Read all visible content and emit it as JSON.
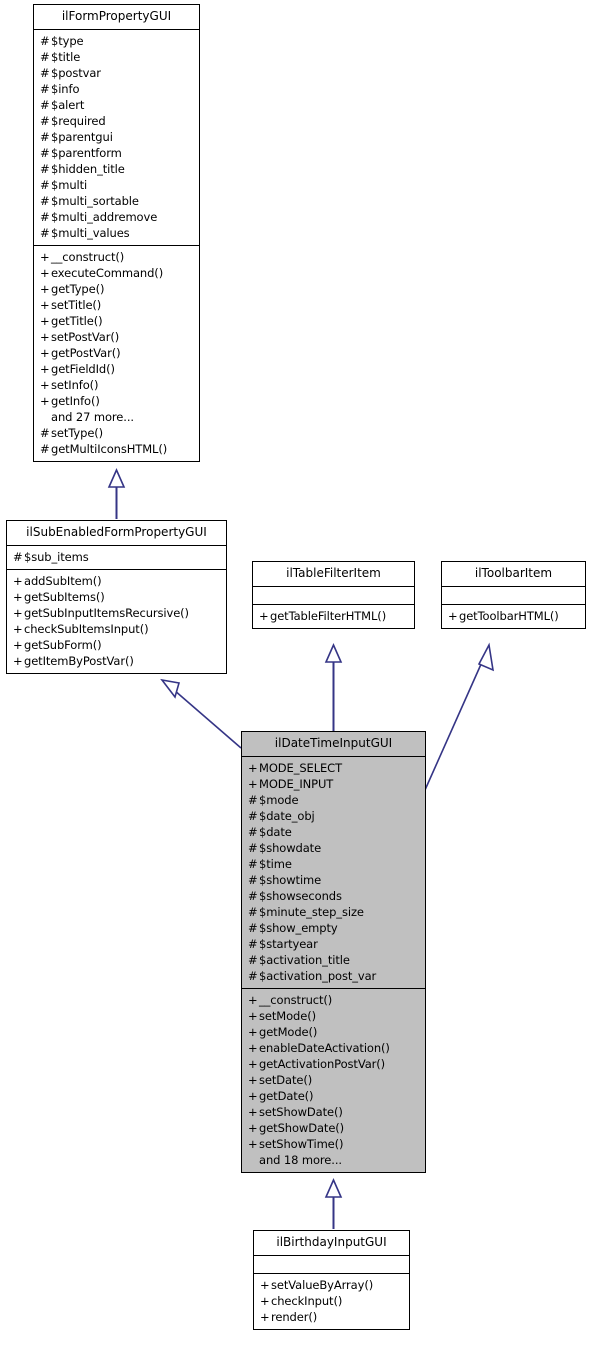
{
  "diagram": {
    "type": "uml-class-inheritance",
    "title": "ilDateTimeInputGUI class hierarchy",
    "line_color": "#353586",
    "highlight_fill": "#c0c0c0",
    "node_fill": "#ffffff",
    "border_color": "#000000"
  },
  "nodes": {
    "il_form_property_gui": {
      "name": "ilFormPropertyGUI",
      "attributes": [
        {
          "visibility": "#",
          "label": "$type"
        },
        {
          "visibility": "#",
          "label": "$title"
        },
        {
          "visibility": "#",
          "label": "$postvar"
        },
        {
          "visibility": "#",
          "label": "$info"
        },
        {
          "visibility": "#",
          "label": "$alert"
        },
        {
          "visibility": "#",
          "label": "$required"
        },
        {
          "visibility": "#",
          "label": "$parentgui"
        },
        {
          "visibility": "#",
          "label": "$parentform"
        },
        {
          "visibility": "#",
          "label": "$hidden_title"
        },
        {
          "visibility": "#",
          "label": "$multi"
        },
        {
          "visibility": "#",
          "label": "$multi_sortable"
        },
        {
          "visibility": "#",
          "label": "$multi_addremove"
        },
        {
          "visibility": "#",
          "label": "$multi_values"
        }
      ],
      "operations": [
        {
          "visibility": "+",
          "label": "__construct()"
        },
        {
          "visibility": "+",
          "label": "executeCommand()"
        },
        {
          "visibility": "+",
          "label": "getType()"
        },
        {
          "visibility": "+",
          "label": "setTitle()"
        },
        {
          "visibility": "+",
          "label": "getTitle()"
        },
        {
          "visibility": "+",
          "label": "setPostVar()"
        },
        {
          "visibility": "+",
          "label": "getPostVar()"
        },
        {
          "visibility": "+",
          "label": "getFieldId()"
        },
        {
          "visibility": "+",
          "label": "setInfo()"
        },
        {
          "visibility": "+",
          "label": "getInfo()"
        },
        {
          "visibility": "",
          "label": "and 27 more..."
        },
        {
          "visibility": "#",
          "label": "setType()"
        },
        {
          "visibility": "#",
          "label": "getMultiIconsHTML()"
        }
      ]
    },
    "il_sub_enabled_form_property_gui": {
      "name": "ilSubEnabledFormPropertyGUI",
      "attributes": [
        {
          "visibility": "#",
          "label": "$sub_items"
        }
      ],
      "operations": [
        {
          "visibility": "+",
          "label": "addSubItem()"
        },
        {
          "visibility": "+",
          "label": "getSubItems()"
        },
        {
          "visibility": "+",
          "label": "getSubInputItemsRecursive()"
        },
        {
          "visibility": "+",
          "label": "checkSubItemsInput()"
        },
        {
          "visibility": "+",
          "label": "getSubForm()"
        },
        {
          "visibility": "+",
          "label": "getItemByPostVar()"
        }
      ]
    },
    "il_table_filter_item": {
      "name": "ilTableFilterItem",
      "attributes": [],
      "operations": [
        {
          "visibility": "+",
          "label": "getTableFilterHTML()"
        }
      ]
    },
    "il_toolbar_item": {
      "name": "ilToolbarItem",
      "attributes": [],
      "operations": [
        {
          "visibility": "+",
          "label": "getToolbarHTML()"
        }
      ]
    },
    "il_date_time_input_gui": {
      "name": "ilDateTimeInputGUI",
      "highlighted": true,
      "attributes": [
        {
          "visibility": "+",
          "label": "MODE_SELECT"
        },
        {
          "visibility": "+",
          "label": "MODE_INPUT"
        },
        {
          "visibility": "#",
          "label": "$mode"
        },
        {
          "visibility": "#",
          "label": "$date_obj"
        },
        {
          "visibility": "#",
          "label": "$date"
        },
        {
          "visibility": "#",
          "label": "$showdate"
        },
        {
          "visibility": "#",
          "label": "$time"
        },
        {
          "visibility": "#",
          "label": "$showtime"
        },
        {
          "visibility": "#",
          "label": "$showseconds"
        },
        {
          "visibility": "#",
          "label": "$minute_step_size"
        },
        {
          "visibility": "#",
          "label": "$show_empty"
        },
        {
          "visibility": "#",
          "label": "$startyear"
        },
        {
          "visibility": "#",
          "label": "$activation_title"
        },
        {
          "visibility": "#",
          "label": "$activation_post_var"
        }
      ],
      "operations": [
        {
          "visibility": "+",
          "label": "__construct()"
        },
        {
          "visibility": "+",
          "label": "setMode()"
        },
        {
          "visibility": "+",
          "label": "getMode()"
        },
        {
          "visibility": "+",
          "label": "enableDateActivation()"
        },
        {
          "visibility": "+",
          "label": "getActivationPostVar()"
        },
        {
          "visibility": "+",
          "label": "setDate()"
        },
        {
          "visibility": "+",
          "label": "getDate()"
        },
        {
          "visibility": "+",
          "label": "setShowDate()"
        },
        {
          "visibility": "+",
          "label": "getShowDate()"
        },
        {
          "visibility": "+",
          "label": "setShowTime()"
        },
        {
          "visibility": "",
          "label": "and 18 more..."
        }
      ]
    },
    "il_birthday_input_gui": {
      "name": "ilBirthdayInputGUI",
      "attributes": [],
      "operations": [
        {
          "visibility": "+",
          "label": "setValueByArray()"
        },
        {
          "visibility": "+",
          "label": "checkInput()"
        },
        {
          "visibility": "+",
          "label": "render()"
        }
      ]
    }
  },
  "edges": [
    {
      "from": "il_sub_enabled_form_property_gui",
      "to": "il_form_property_gui",
      "kind": "generalization"
    },
    {
      "from": "il_date_time_input_gui",
      "to": "il_sub_enabled_form_property_gui",
      "kind": "generalization"
    },
    {
      "from": "il_date_time_input_gui",
      "to": "il_table_filter_item",
      "kind": "generalization"
    },
    {
      "from": "il_date_time_input_gui",
      "to": "il_toolbar_item",
      "kind": "generalization"
    },
    {
      "from": "il_birthday_input_gui",
      "to": "il_date_time_input_gui",
      "kind": "generalization"
    }
  ]
}
